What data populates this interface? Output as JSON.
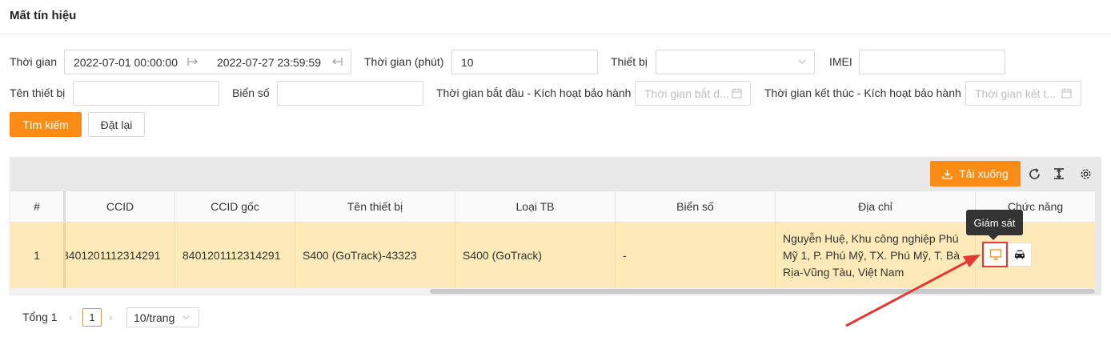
{
  "page": {
    "title": "Mất tín hiệu"
  },
  "filters": {
    "time_label": "Thời gian",
    "time_start": "2022-07-01 00:00:00",
    "time_end": "2022-07-27 23:59:59",
    "minutes_label": "Thời gian (phút)",
    "minutes_value": "10",
    "device_label": "Thiết bị",
    "device_value": "",
    "imei_label": "IMEI",
    "imei_value": "",
    "device_name_label": "Tên thiết bị",
    "device_name_value": "",
    "plate_label": "Biển số",
    "plate_value": "",
    "warranty_start_label": "Thời gian bắt đầu - Kích hoạt bảo hành",
    "warranty_start_placeholder": "Thời gian bắt đ...",
    "warranty_end_label": "Thời gian kết thúc - Kích hoạt bảo hành",
    "warranty_end_placeholder": "Thời gian kết t..."
  },
  "actions": {
    "search": "Tìm kiếm",
    "reset": "Đặt lại",
    "download": "Tải xuống"
  },
  "table": {
    "headers": [
      "#",
      "CCID",
      "CCID gốc",
      "Tên thiết bị",
      "Loại TB",
      "Biển số",
      "Địa chỉ",
      "Chức năng"
    ],
    "rows": [
      {
        "index": "1",
        "ccid": "8401201112314291",
        "ccid_origin": "8401201112314291",
        "device_name": "S400 (GoTrack)-43323",
        "device_type": "S400 (GoTrack)",
        "plate": "-",
        "address": "Nguyễn Huệ, Khu công nghiệp Phú Mỹ 1, P. Phú Mỹ, TX. Phú Mỹ, T. Bà Rịa-Vũng Tàu, Việt Nam"
      }
    ],
    "tooltip": "Giám sát"
  },
  "pagination": {
    "total": "Tổng 1",
    "page": "1",
    "page_size": "10/trang"
  },
  "colors": {
    "accent": "#fa8c16",
    "row_highlight": "#fdeab8",
    "annotation": "#e53935"
  }
}
